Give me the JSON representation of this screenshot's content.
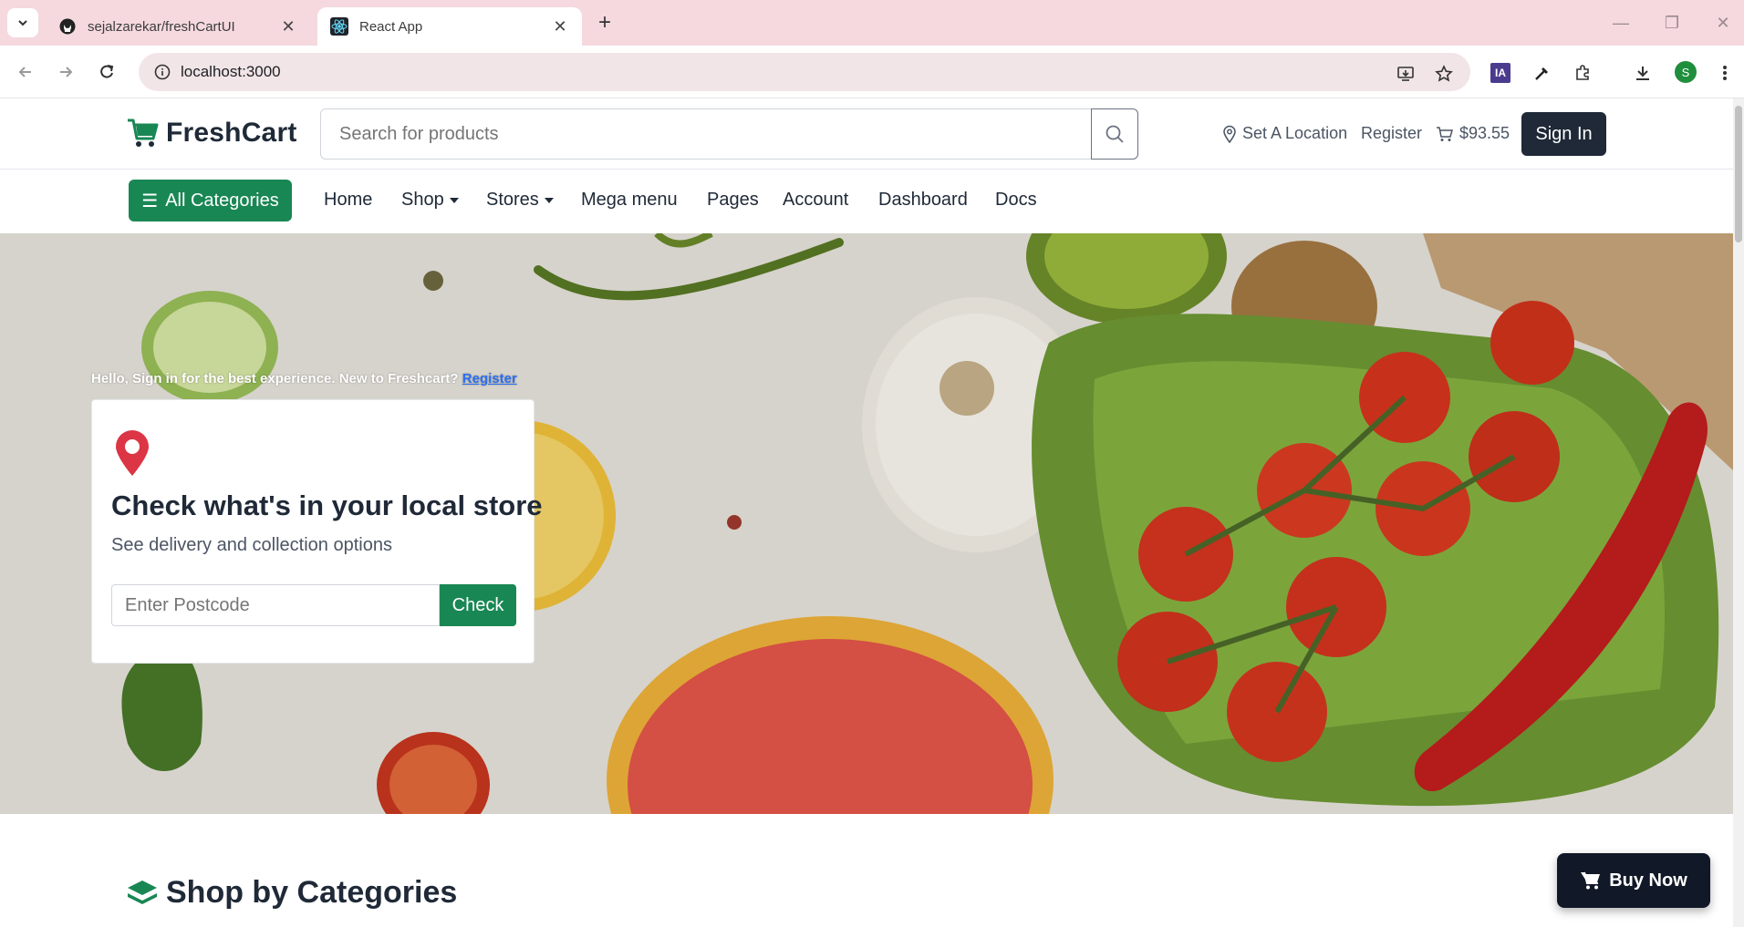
{
  "browser": {
    "tabs": [
      {
        "title": "sejalzarekar/freshCartUI",
        "active": false,
        "favicon": "github-icon"
      },
      {
        "title": "React App",
        "active": true,
        "favicon": "react-icon"
      }
    ],
    "url": "localhost:3000",
    "profile_initial": "S",
    "extension_label": "IA"
  },
  "header": {
    "brand": "FreshCart",
    "search_placeholder": "Search for products",
    "location_label": "Set A Location",
    "register_label": "Register",
    "cart_total": "$93.55",
    "signin_label": "Sign In"
  },
  "nav": {
    "all_categories": "All Categories",
    "items": [
      "Home",
      "Shop",
      "Stores",
      "Mega menu",
      "Pages",
      "Account",
      "Dashboard",
      "Docs"
    ]
  },
  "hero": {
    "greeting": "Hello, Sign in for the best experience. New to Freshcart?",
    "greeting_link": "Register",
    "card_title": "Check what's in your local store",
    "card_subtitle": "See delivery and collection options",
    "postcode_placeholder": "Enter Postcode",
    "check_label": "Check"
  },
  "section": {
    "title": "Shop by Categories"
  },
  "floating": {
    "buy_now": "Buy Now"
  },
  "colors": {
    "brand_green": "#198754",
    "dark": "#1f2937",
    "tabbar": "#f5d9df"
  }
}
